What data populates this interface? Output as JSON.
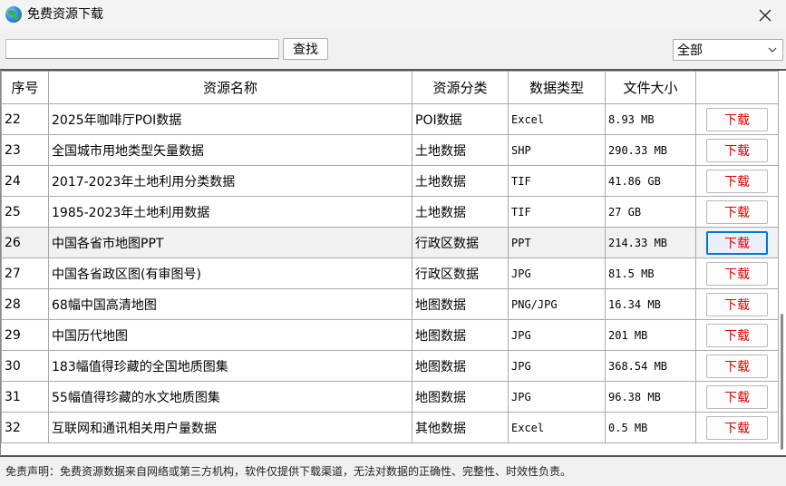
{
  "window": {
    "title": "免费资源下载",
    "app_icon": "globe-icon",
    "close_icon": "close-icon"
  },
  "toolbar": {
    "search_value": "",
    "search_button_label": "查找",
    "category_selected": "全部",
    "dropdown_icon": "chevron-down-icon"
  },
  "table": {
    "headers": {
      "index": "序号",
      "name": "资源名称",
      "category": "资源分类",
      "data_type": "数据类型",
      "file_size": "文件大小",
      "action": ""
    },
    "download_label": "下载",
    "download_color": "#e00000",
    "selected_row_index": "26",
    "rows": [
      {
        "index": "22",
        "name": "2025年咖啡厅POI数据",
        "category": "POI数据",
        "data_type": "Excel",
        "file_size": "8.93 MB"
      },
      {
        "index": "23",
        "name": "全国城市用地类型矢量数据",
        "category": "土地数据",
        "data_type": "SHP",
        "file_size": "290.33 MB"
      },
      {
        "index": "24",
        "name": "2017-2023年土地利用分类数据",
        "category": "土地数据",
        "data_type": "TIF",
        "file_size": "41.86 GB"
      },
      {
        "index": "25",
        "name": "1985-2023年土地利用数据",
        "category": "土地数据",
        "data_type": "TIF",
        "file_size": "27 GB"
      },
      {
        "index": "26",
        "name": "中国各省市地图PPT",
        "category": "行政区数据",
        "data_type": "PPT",
        "file_size": "214.33 MB"
      },
      {
        "index": "27",
        "name": "中国各省政区图(有审图号)",
        "category": "行政区数据",
        "data_type": "JPG",
        "file_size": "81.5 MB"
      },
      {
        "index": "28",
        "name": "68幅中国高清地图",
        "category": "地图数据",
        "data_type": "PNG/JPG",
        "file_size": "16.34 MB"
      },
      {
        "index": "29",
        "name": "中国历代地图",
        "category": "地图数据",
        "data_type": "JPG",
        "file_size": "201 MB"
      },
      {
        "index": "30",
        "name": "183幅值得珍藏的全国地质图集",
        "category": "地图数据",
        "data_type": "JPG",
        "file_size": "368.54 MB"
      },
      {
        "index": "31",
        "name": "55幅值得珍藏的水文地质图集",
        "category": "地图数据",
        "data_type": "JPG",
        "file_size": "96.38 MB"
      },
      {
        "index": "32",
        "name": "互联网和通讯相关用户量数据",
        "category": "其他数据",
        "data_type": "Excel",
        "file_size": "0.5 MB"
      }
    ]
  },
  "footer": {
    "disclaimer": "免责声明：免费资源数据来自网络或第三方机构，软件仅提供下载渠道，无法对数据的正确性、完整性、时效性负责。"
  }
}
